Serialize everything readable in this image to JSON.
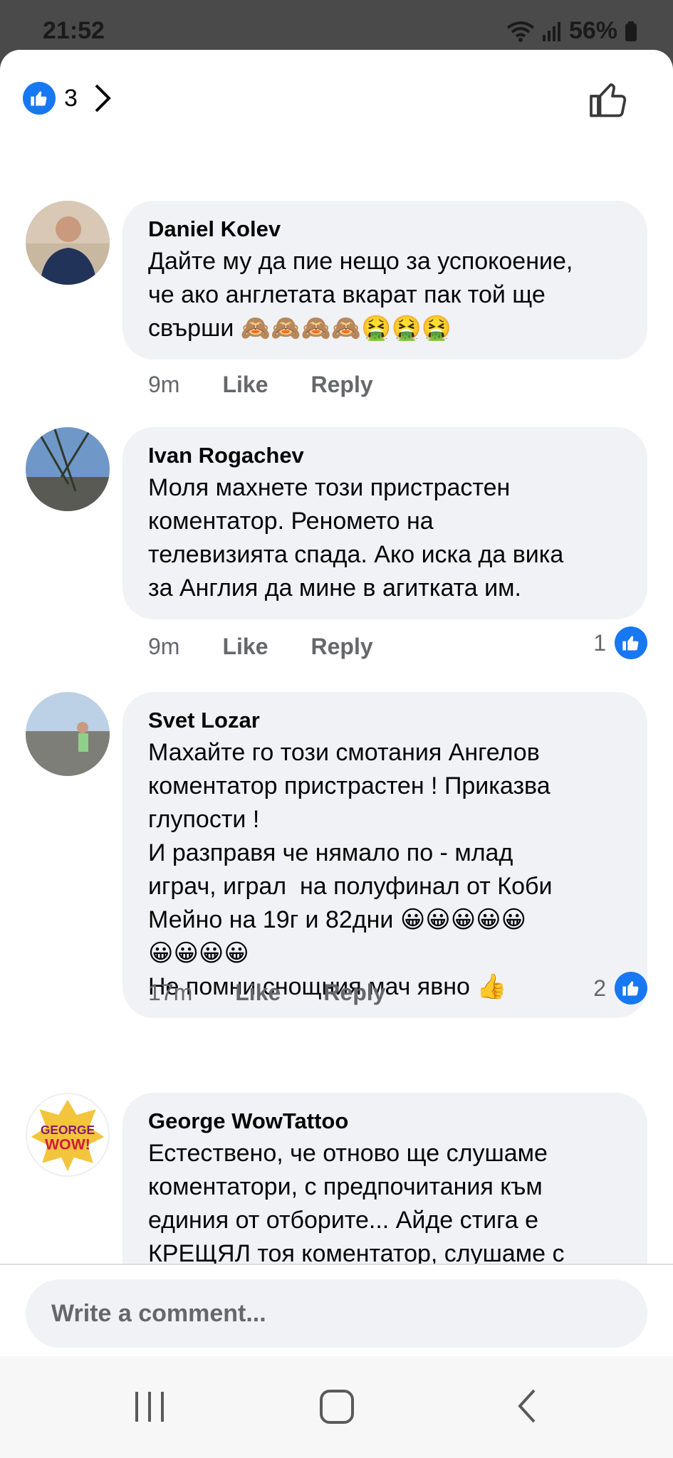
{
  "status": {
    "time": "21:52",
    "battery": "56%"
  },
  "header": {
    "reaction_count": "3"
  },
  "comments": [
    {
      "author": "Daniel Kolev",
      "text": "Дайте му да пие нещо за успокоение,\nче ако англетата вкарат пак той ще\nсвърши 🙈🙈🙈🙈🤮🤮🤮",
      "time": "9m",
      "like": "Like",
      "reply": "Reply",
      "reactions": ""
    },
    {
      "author": "Ivan Rogachev",
      "text": "Моля махнете този пристрастен\nкоментатор. Реномето на\nтелевизията спада. Ако иска да вика\nза Англия да мине в агитката им.",
      "time": "9m",
      "like": "Like",
      "reply": "Reply",
      "reactions": "1"
    },
    {
      "author": "Svet Lozar",
      "text": "Махайте го този смотания Ангелов\nкоментатор пристрастен ! Приказва\nглупости !\nИ разправя че нямало по - млад\nиграч, играл  на полуфинал от Коби\nМейно на 19г и 82дни 😀😀😀😀😀\n😀😀😀😀\nНе помни снощния мач явно 👍",
      "time": "17m",
      "like": "Like",
      "reply": "Reply",
      "reactions": "2"
    },
    {
      "author": "George WowTattoo",
      "text": "Естествено, че отново ще слушаме\nкоментатори, с предпочитания към\nединия от отборите... Айде стига е\nКРЕЩЯЛ тоя коментатор, слушаме с\nушите си тукааааaа 😵‍💫😵‍💫🤦‍♂️🤦‍♂️",
      "time": "",
      "like": "",
      "reply": "",
      "reactions": ""
    }
  ],
  "composer": {
    "placeholder": "Write a comment..."
  },
  "avatar_badge": {
    "text": "GEORGE WOW!"
  },
  "colors": {
    "accent": "#1877f2",
    "bubble": "#f0f2f5",
    "meta": "#65676b"
  }
}
